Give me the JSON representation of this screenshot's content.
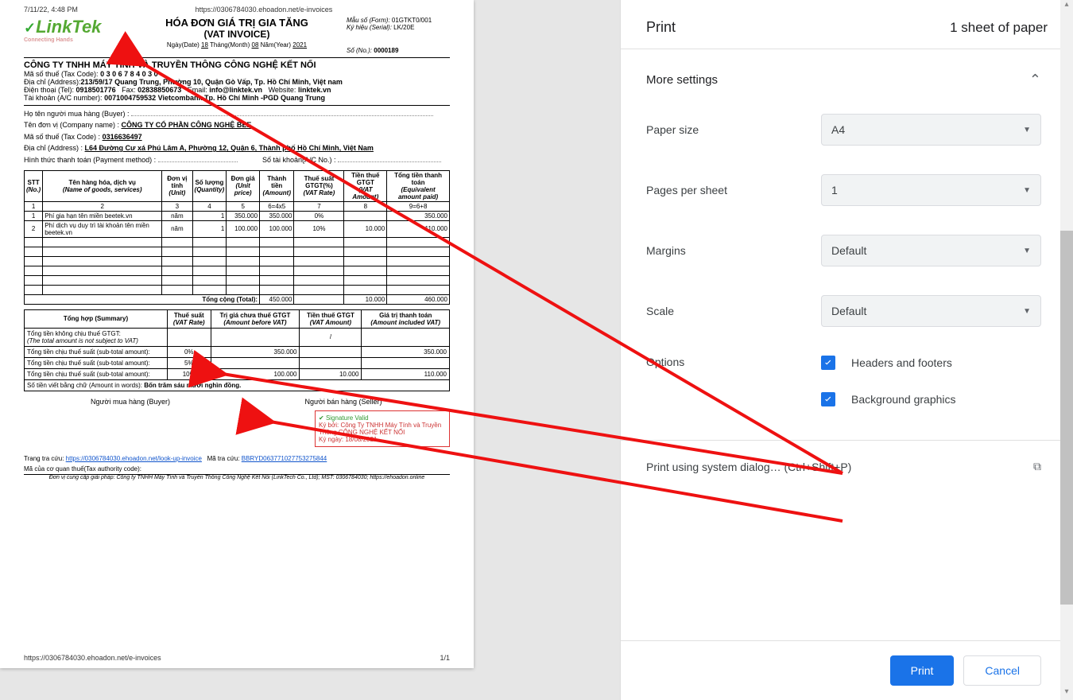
{
  "hf": {
    "datetime": "7/11/22, 4:48 PM",
    "url_top": "https://0306784030.ehoadon.net/e-invoices",
    "url_bottom": "https://0306784030.ehoadon.net/e-invoices",
    "page": "1/1"
  },
  "logo": {
    "brand": "LinkTek",
    "tag": "Connecting  Hands"
  },
  "invoice": {
    "title": "HÓA ĐƠN GIÁ TRỊ GIA TĂNG",
    "subtitle": "(VAT INVOICE)",
    "date_label": "Ngày(Date)",
    "date_day": "18",
    "date_month_lbl": "Tháng(Month)",
    "date_month": "08",
    "date_year_lbl": "Năm(Year)",
    "date_year": "2021",
    "form_lbl": "Mẫu số (Form):",
    "form": "01GTKT0/001",
    "serial_lbl": "Ký hiệu (Serial):",
    "serial": "LK/20E",
    "no_lbl": "Số (No.):",
    "no": "0000189"
  },
  "seller": {
    "name": "CÔNG TY TNHH MÁY TÍNH VÀ TRUYỀN THÔNG CÔNG NGHỆ KẾT NỐI",
    "tax_lbl": "Mã số thuế (Tax Code):",
    "tax": "0 3 0 6 7 8 4 0 3 0",
    "addr_lbl": "Địa chỉ (Address):",
    "addr": "213/59/17 Quang Trung, Phường 10, Quận Gò Vấp, Tp. Hồ Chí Minh, Việt nam",
    "tel_lbl": "Điện thoại (Tel):",
    "tel": "0918501776",
    "fax_lbl": "Fax:",
    "fax": "02838850673",
    "email_lbl": "Email:",
    "email": "info@linktek.vn",
    "web_lbl": "Website:",
    "web": "linktek.vn",
    "acc_lbl": "Tài khoản (A/C number):",
    "acc": "0071004759532  Vietcombank Tp. Hồ Chí Minh  -PGD Quang Trung"
  },
  "buyer": {
    "name_lbl": "Họ tên người mua hàng (Buyer) :",
    "company_lbl": "Tên đơn vị (Company name) :",
    "company": "CÔNG TY CỔ PHẦN CÔNG NGHỆ BEE",
    "tax_lbl": "Mã số thuế (Tax Code)  :",
    "tax": "0316636497",
    "addr_lbl": "Địa chỉ (Address)  :",
    "addr": "L64 Đường Cư xá Phú Lâm A, Phường 12, Quận 6, Thành phố Hồ Chí Minh, Việt Nam",
    "pay_lbl": "Hình thức thanh toán (Payment method) :",
    "acc2_lbl": "Số tài khoản(A/C No.) :"
  },
  "headers": {
    "stt": "STT",
    "stt_e": "(No.)",
    "name": "Tên hàng hóa, dịch vụ",
    "name_e": "(Name of goods, services)",
    "unit": "Đơn vị tính",
    "unit_e": "(Unit)",
    "qty": "Số lượng",
    "qty_e": "(Quantity)",
    "price": "Đơn giá",
    "price_e": "(Unit price)",
    "amount": "Thành tiền",
    "amount_e": "(Amount)",
    "rate": "Thuế suất GTGT(%)",
    "rate_e": "(VAT Rate)",
    "vat": "Tiền thuế GTGT",
    "vat_e": "(VAT Amount)",
    "total": "Tổng tiền thanh toán",
    "total_e": "(Equivalent amount paid)",
    "formula": {
      "c1": "1",
      "c2": "2",
      "c3": "3",
      "c4": "4",
      "c5": "5",
      "c6": "6=4x5",
      "c7": "7",
      "c8": "8",
      "c9": "9=6+8"
    },
    "grand": "Tổng cộng (Total):"
  },
  "items": [
    {
      "no": "1",
      "name": "Phí gia hạn tên miền beetek.vn",
      "unit": "năm",
      "qty": "1",
      "price": "350.000",
      "amount": "350.000",
      "rate": "0%",
      "vat": "",
      "total": "350.000"
    },
    {
      "no": "2",
      "name": "Phí dịch vụ duy trì tài khoản tên miền beetek.vn",
      "unit": "năm",
      "qty": "1",
      "price": "100.000",
      "amount": "100.000",
      "rate": "10%",
      "vat": "10.000",
      "total": "110.000"
    }
  ],
  "grand": {
    "amount": "450.000",
    "vat": "10.000",
    "total": "460.000"
  },
  "summary": {
    "h1": "Tổng hợp (Summary)",
    "h2": "Thuế suất",
    "h2e": "(VAT Rate)",
    "h3": "Trị giá chưa thuế GTGT",
    "h3e": "(Amount before VAT)",
    "h4": "Tiền thuế GTGT",
    "h4e": "(VAT Amount)",
    "h5": "Giá trị thanh toán",
    "h5e": "(Amount included VAT)",
    "r1": "Tổng tiền không chịu thuế GTGT:",
    "r1e": "(The total amount is not subject to VAT)",
    "r2": "Tổng tiền chịu thuế suất (sub-total amount):",
    "v_r2_rate": "0%",
    "v_r2_before": "350.000",
    "v_r2_vat": "",
    "v_r2_ttl": "350.000",
    "v_r3_rate": "5%",
    "v_r4_rate": "10%",
    "v_r4_before": "100.000",
    "v_r4_vat": "10.000",
    "v_r4_ttl": "110.000",
    "words_lbl": "Số tiền viết bằng chữ (Amount in words):",
    "words": "Bốn trăm sáu mươi nghìn đồng."
  },
  "sign": {
    "buyer": "Người mua hàng (Buyer)",
    "seller": "Người bán hàng (Seller)",
    "valid": "Signature Valid",
    "by": "Ký bởi: Công Ty TNHH Máy Tính và Truyền Thông CÔNG NGHỆ KẾT NỐI",
    "date": "Ký ngày: 18/08/2021"
  },
  "lookup": {
    "lbl": "Trang tra cứu:",
    "url": "https://0306784030.ehoadon.net/look-up-invoice",
    "mtc_lbl": "Mã tra cứu:",
    "mtc": "BBRYD063771027753275844",
    "tac": "Mã của cơ quan thuế(Tax authority code):",
    "footer": "Đơn vị cung cấp giải pháp: Công ty TNHH Máy Tính và Truyền Thông Công Nghệ Kết Nối (LinkTech Co., Ltd); MST: 0306784030; https://ehoadon.online"
  },
  "print": {
    "title": "Print",
    "sheets": "1 sheet of paper",
    "more": "More settings",
    "paper_lbl": "Paper size",
    "paper": "A4",
    "pps_lbl": "Pages per sheet",
    "pps": "1",
    "margins_lbl": "Margins",
    "margins": "Default",
    "scale_lbl": "Scale",
    "scale": "Default",
    "options_lbl": "Options",
    "opt_hf": "Headers and footers",
    "opt_bg": "Background graphics",
    "sys": "Print using system dialog… (Ctrl+Shift+P)",
    "go": "Print",
    "cancel": "Cancel"
  }
}
